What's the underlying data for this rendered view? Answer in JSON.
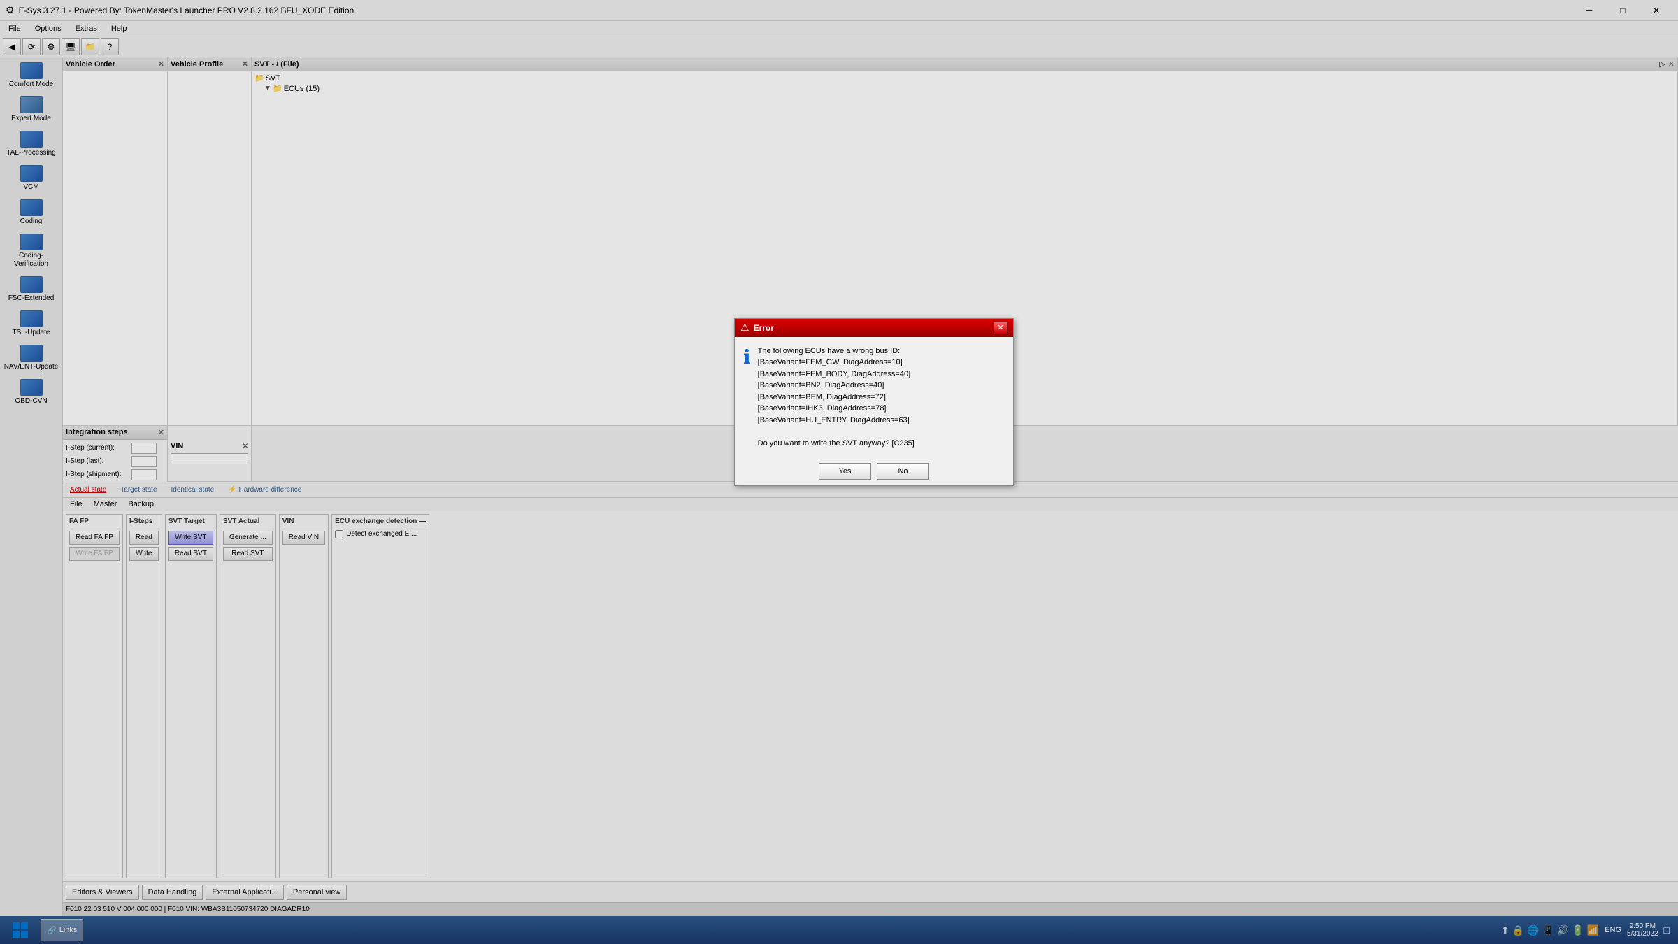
{
  "window": {
    "title": "E-Sys 3.27.1 - Powered By: TokenMaster's Launcher PRO V2.8.2.162 BFU_XODE Edition",
    "titlebar_icon": "⚙"
  },
  "menu": {
    "items": [
      "File",
      "Options",
      "Extras",
      "Help"
    ]
  },
  "toolbar": {
    "buttons": [
      "◀",
      "⟳",
      "🔧",
      "🖥",
      "📄",
      "💾",
      "❓"
    ]
  },
  "sidebar": {
    "sections": [
      {
        "label": "Comfort Mode"
      },
      {
        "label": "Expert Mode"
      },
      {
        "label": "TAL-Processing"
      },
      {
        "label": "VCM"
      },
      {
        "label": "Coding"
      },
      {
        "label": "Coding-Verification"
      },
      {
        "label": "FSC-Extended"
      },
      {
        "label": "TSL-Update"
      },
      {
        "label": "NAV/ENT-Update"
      },
      {
        "label": "OBD-CVN"
      }
    ]
  },
  "panels": {
    "vehicle_order": {
      "title": "Vehicle Order"
    },
    "vehicle_profile": {
      "title": "Vehicle Profile"
    },
    "svt": {
      "title": "SVT - / (File)",
      "tree": {
        "root": "SVT",
        "children": [
          {
            "label": "ECUs (15)",
            "expanded": true
          }
        ]
      }
    }
  },
  "integration_steps": {
    "title": "Integration steps",
    "fields": [
      {
        "label": "I-Step (current):",
        "value": ""
      },
      {
        "label": "I-Step (last):",
        "value": ""
      },
      {
        "label": "I-Step (shipment):",
        "value": ""
      }
    ]
  },
  "vin_panel": {
    "title": "VIN",
    "value": ""
  },
  "status_bar": {
    "actual_state": "Actual state",
    "target_state": "Target state",
    "identical_state": "Identical state",
    "hardware_difference": "⚡ Hardware difference"
  },
  "file_menu": {
    "items": [
      "File",
      "Master",
      "Backup"
    ]
  },
  "action_groups": {
    "fa_fp": {
      "title": "FA FP",
      "buttons": [
        "Read FA FP",
        "Write FA FP"
      ]
    },
    "i_steps": {
      "title": "I-Steps",
      "buttons": [
        "Read",
        "Write"
      ]
    },
    "svt_target": {
      "title": "SVT Target",
      "buttons": [
        "Write SVT",
        "Read SVT"
      ]
    },
    "svt_actual": {
      "title": "SVT Actual",
      "buttons": [
        "Generate ...",
        "Read SVT"
      ]
    },
    "vin": {
      "title": "VIN",
      "buttons": [
        "Read VIN"
      ]
    }
  },
  "ecu_detection": {
    "title": "ECU exchange detection —",
    "checkbox_label": "Detect exchanged E....",
    "checked": false
  },
  "bottom_tools": {
    "items": [
      "Editors & Viewers",
      "Data Handling",
      "External Applicati...",
      "Personal view"
    ]
  },
  "error_dialog": {
    "title": "Error",
    "message_lines": [
      "The following ECUs have a wrong bus ID:",
      "[BaseVariant=FEM_GW, DiagAddress=10]",
      "[BaseVariant=FEM_BODY, DiagAddress=40]",
      "[BaseVariant=BN2, DiagAddress=40]",
      "[BaseVariant=BEM, DiagAddress=72]",
      "[BaseVariant=IHK3, DiagAddress=78]",
      "[BaseVariant=HU_ENTRY, DiagAddress=63].",
      "",
      "Do you want to write the SVT anyway? [C235]"
    ],
    "yes_label": "Yes",
    "no_label": "No"
  },
  "info_bar": {
    "text": "F010  22  03  510  V  004  000  000  | F010  VIN: WBA3B11050734720  DIAGADR10"
  },
  "taskbar": {
    "start_label": "⊞",
    "items": [
      "Links"
    ],
    "system_icons": [
      "🔔",
      "🔊",
      "🔋",
      "📶"
    ],
    "lang": "ENG",
    "time": "9:50 PM",
    "date": "5/31/2022",
    "tray_icons": [
      "⬆",
      "🔒",
      "🌐",
      "📱",
      "🎵",
      "🌿",
      "🔵",
      "🟢",
      "🔵"
    ]
  }
}
